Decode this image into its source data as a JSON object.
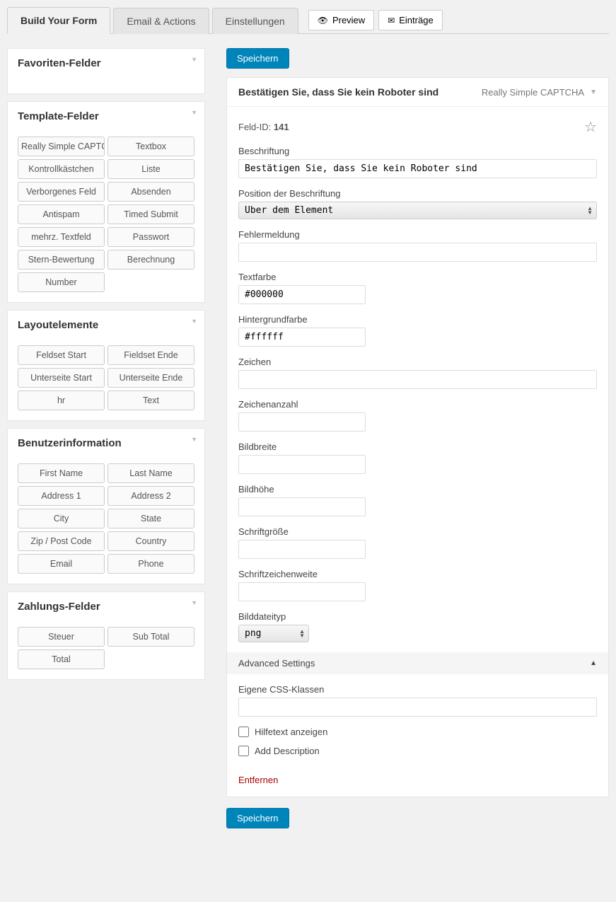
{
  "tabs": {
    "build": "Build Your Form",
    "email": "Email & Actions",
    "settings": "Einstellungen",
    "preview": "Preview",
    "entries": "Einträge"
  },
  "buttons": {
    "save": "Speichern"
  },
  "sidebar": {
    "favoriten": {
      "title": "Favoriten-Felder"
    },
    "template": {
      "title": "Template-Felder",
      "items": [
        "Really Simple CAPTCHA",
        "Textbox",
        "Kontrollkästchen",
        "Liste",
        "Verborgenes Feld",
        "Absenden",
        "Antispam",
        "Timed Submit",
        "mehrz. Textfeld",
        "Passwort",
        "Stern-Bewertung",
        "Berechnung",
        "Number"
      ]
    },
    "layout": {
      "title": "Layoutelemente",
      "items": [
        "Feldset Start",
        "Fieldset Ende",
        "Unterseite Start",
        "Unterseite Ende",
        "hr",
        "Text"
      ]
    },
    "user": {
      "title": "Benutzerinformation",
      "items": [
        "First Name",
        "Last Name",
        "Address 1",
        "Address 2",
        "City",
        "State",
        "Zip / Post Code",
        "Country",
        "Email",
        "Phone"
      ]
    },
    "payment": {
      "title": "Zahlungs-Felder",
      "items": [
        "Steuer",
        "Sub Total",
        "Total"
      ]
    }
  },
  "editor": {
    "title": "Bestätigen Sie, dass Sie kein Roboter sind",
    "type": "Really Simple CAPTCHA",
    "field_id_label": "Feld-ID:",
    "field_id": "141",
    "labels": {
      "beschriftung": "Beschriftung",
      "position": "Position der Beschriftung",
      "fehler": "Fehlermeldung",
      "textfarbe": "Textfarbe",
      "hintergrund": "Hintergrundfarbe",
      "zeichen": "Zeichen",
      "zeichenanzahl": "Zeichenanzahl",
      "bildbreite": "Bildbreite",
      "bildhoehe": "Bildhöhe",
      "schriftgroesse": "Schriftgröße",
      "schriftweite": "Schriftzeichenweite",
      "bildtyp": "Bilddateityp",
      "advanced": "Advanced Settings",
      "cssklassen": "Eigene CSS-Klassen",
      "hilfetext": "Hilfetext anzeigen",
      "description": "Add Description",
      "remove": "Entfernen"
    },
    "values": {
      "beschriftung": "Bestätigen Sie, dass Sie kein Roboter sind",
      "position": "Über dem Element",
      "fehler": "",
      "textfarbe": "#000000",
      "hintergrund": "#ffffff",
      "zeichen": "",
      "zeichenanzahl": "",
      "bildbreite": "",
      "bildhoehe": "",
      "schriftgroesse": "",
      "schriftweite": "",
      "bildtyp": "png",
      "cssklassen": ""
    }
  }
}
